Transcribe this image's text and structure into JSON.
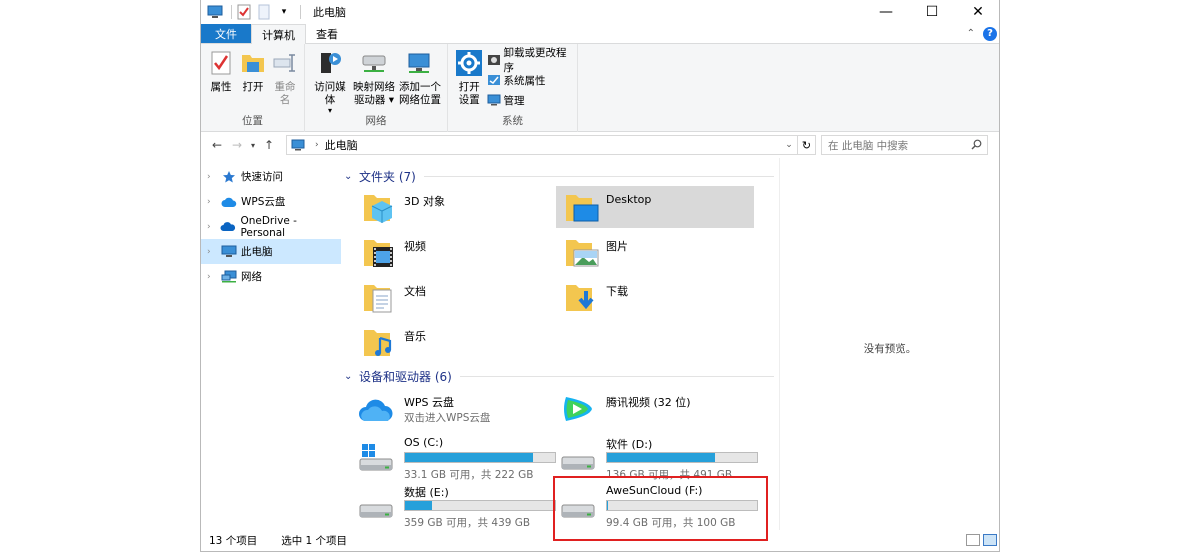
{
  "window": {
    "title": "此电脑"
  },
  "tabs": {
    "file": "文件",
    "computer": "计算机",
    "view": "查看"
  },
  "ribbon": {
    "location": {
      "label": "位置",
      "properties": "属性",
      "open": "打开",
      "rename": "重命名"
    },
    "network": {
      "label": "网络",
      "access_media_1": "访问媒体",
      "map_drive_1": "映射网络",
      "map_drive_2": "驱动器",
      "add_location_1": "添加一个",
      "add_location_2": "网络位置"
    },
    "system": {
      "label": "系统",
      "open_settings_1": "打开",
      "open_settings_2": "设置",
      "uninstall": "卸载或更改程序",
      "sys_properties": "系统属性",
      "manage": "管理"
    }
  },
  "address": {
    "crumb": "此电脑",
    "search_placeholder": "在 此电脑 中搜索"
  },
  "nav": {
    "items": [
      {
        "label": "快速访问"
      },
      {
        "label": "WPS云盘"
      },
      {
        "label": "OneDrive - Personal"
      },
      {
        "label": "此电脑"
      },
      {
        "label": "网络"
      }
    ]
  },
  "content": {
    "folders_header": "文件夹 (7)",
    "folders": [
      {
        "name": "3D 对象"
      },
      {
        "name": "Desktop"
      },
      {
        "name": "视频"
      },
      {
        "name": "图片"
      },
      {
        "name": "文档"
      },
      {
        "name": "下载"
      },
      {
        "name": "音乐"
      }
    ],
    "devices_header": "设备和驱动器 (6)",
    "devices": [
      {
        "name": "WPS 云盘",
        "sub": "双击进入WPS云盘"
      },
      {
        "name": "腾讯视频 (32 位)"
      },
      {
        "name": "OS (C:)",
        "sub": "33.1 GB 可用，共 222 GB",
        "used_fraction": 0.85
      },
      {
        "name": "软件 (D:)",
        "sub": "136 GB 可用，共 491 GB",
        "used_fraction": 0.72
      },
      {
        "name": "数据 (E:)",
        "sub": "359 GB 可用，共 439 GB",
        "used_fraction": 0.18
      },
      {
        "name": "AweSunCloud (F:)",
        "sub": "99.4 GB 可用，共 100 GB",
        "used_fraction": 0.006
      }
    ]
  },
  "preview": {
    "text": "没有预览。"
  },
  "status": {
    "count": "13 个项目",
    "selected": "选中 1 个项目"
  },
  "colors": {
    "accent": "#1979ca",
    "bar_fill": "#26a0da",
    "highlight": "#e02020",
    "selected_bg": "#cce8ff"
  }
}
